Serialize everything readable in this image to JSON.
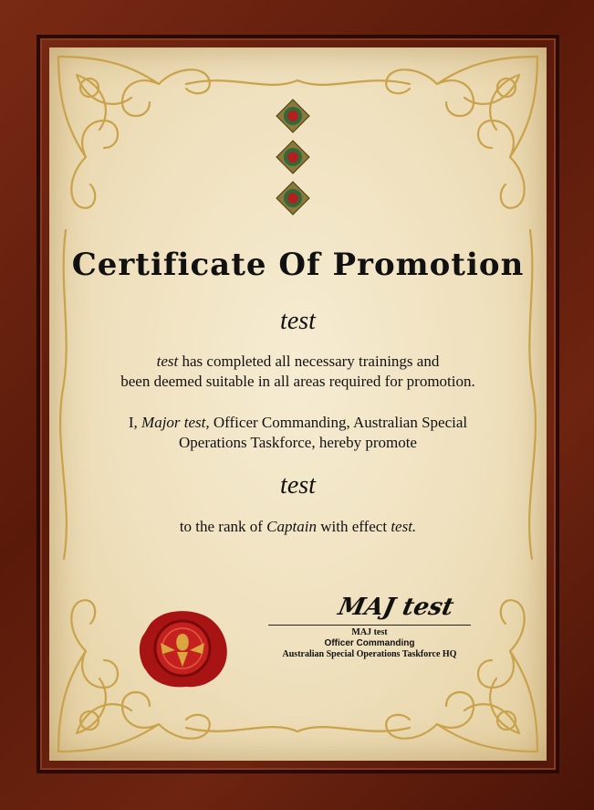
{
  "certificate": {
    "title": "Certificate Of Promotion",
    "recipient_name": "test",
    "paragraph1": {
      "name_italic": "test",
      "line1_rest": " has completed all necessary trainings and",
      "line2": "been deemed suitable in all areas required for promotion."
    },
    "paragraph2": {
      "prefix": "I, ",
      "officer_italic": "Major test,",
      "line1_rest": " Officer Commanding, Australian Special",
      "line2": "Operations Taskforce, hereby promote"
    },
    "promoted_name": "test",
    "paragraph3": {
      "prefix": "to the rank of ",
      "rank_italic": "Captain",
      "middle": " with effect ",
      "date_italic": "test."
    },
    "signature": {
      "script": "MAJ test",
      "name": "MAJ test",
      "role": "Officer Commanding",
      "unit": "Australian Special Operations Taskforce HQ"
    }
  },
  "colors": {
    "frame": "#5a1a0a",
    "paper": "#efe0bd",
    "ornament_gold": "#c9a24a",
    "seal_red": "#b01818"
  },
  "icons": [
    "rank-pip-icon",
    "wax-seal-icon"
  ]
}
